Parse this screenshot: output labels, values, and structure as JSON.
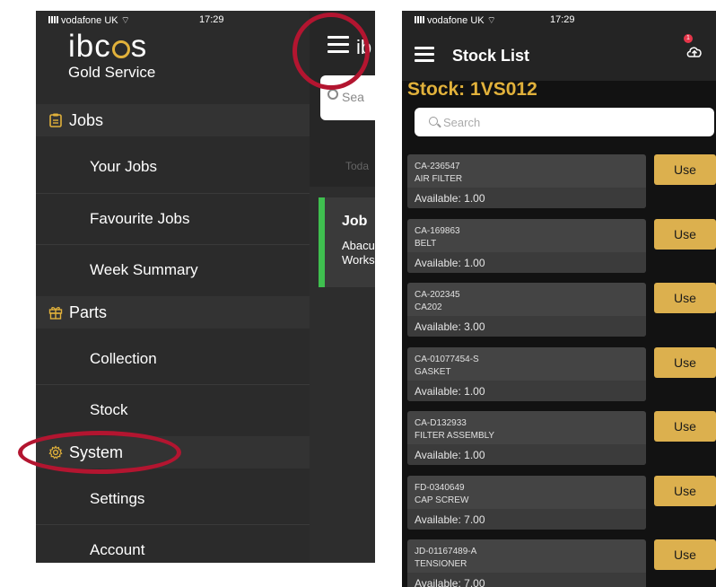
{
  "left_screen": {
    "status": {
      "carrier": "vodafone UK",
      "time": "17:29"
    },
    "brand": "ibcos",
    "subtitle": "Gold Service",
    "sections": [
      {
        "label": "Jobs",
        "icon": "clipboard-icon",
        "items": [
          "Your Jobs",
          "Favourite Jobs",
          "Week Summary"
        ]
      },
      {
        "label": "Parts",
        "icon": "gift-icon",
        "items": [
          "Collection",
          "Stock"
        ]
      },
      {
        "label": "System",
        "icon": "gear-icon",
        "items": [
          "Settings",
          "Account"
        ]
      }
    ],
    "peek": {
      "brand_partial": "ib",
      "search_placeholder": "Sea",
      "today_partial": "Toda",
      "job_title": "Job",
      "job_line1": "Abacu",
      "job_line2": "Works"
    },
    "accent": "#e1b13b",
    "highlight_color": "#b31530"
  },
  "right_screen": {
    "status": {
      "carrier": "vodafone UK",
      "time": "17:29"
    },
    "title": "Stock List",
    "badge_count": "1",
    "stock_heading": "Stock: 1VS012",
    "search_placeholder": "Search",
    "use_label": "Use",
    "items": [
      {
        "code": "CA-236547",
        "desc": "AIR FILTER",
        "available": "Available: 1.00"
      },
      {
        "code": "CA-169863",
        "desc": "BELT",
        "available": "Available: 1.00"
      },
      {
        "code": "CA-202345",
        "desc": "CA202",
        "available": "Available: 3.00"
      },
      {
        "code": "CA-01077454-S",
        "desc": "GASKET",
        "available": "Available: 1.00"
      },
      {
        "code": "CA-D132933",
        "desc": "FILTER ASSEMBLY",
        "available": "Available: 1.00"
      },
      {
        "code": "FD-0340649",
        "desc": "CAP SCREW",
        "available": "Available: 7.00"
      },
      {
        "code": "JD-01167489-A",
        "desc": "TENSIONER",
        "available": "Available: 7.00"
      }
    ],
    "accent": "#dcb04e"
  }
}
